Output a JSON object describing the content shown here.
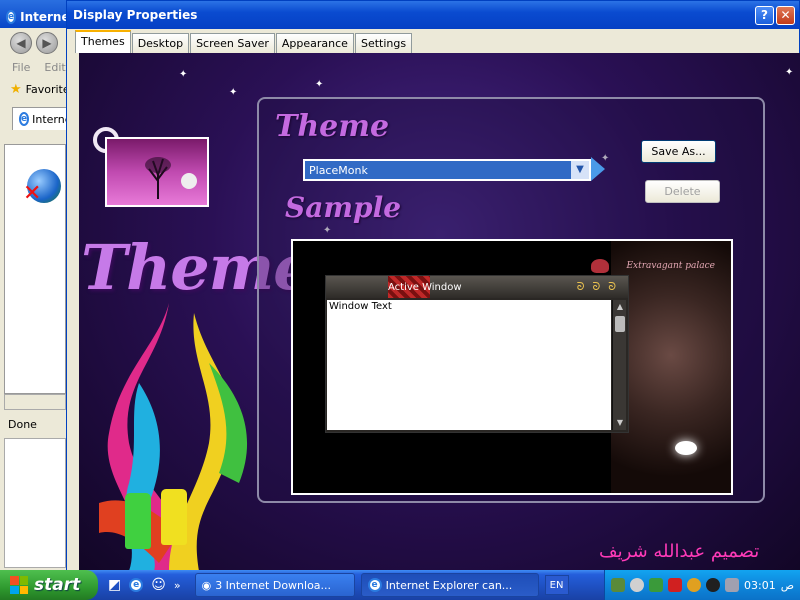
{
  "background_window": {
    "title": "Internet Explorer",
    "menu": [
      "File",
      "Edit"
    ],
    "favorites_label": "Favorites",
    "tab_label": "Internet Explorer",
    "status_text": "Done"
  },
  "dialog": {
    "title": "Display Properties",
    "tabs": [
      "Themes",
      "Desktop",
      "Screen Saver",
      "Appearance",
      "Settings"
    ],
    "active_tab": "Themes",
    "theme_label": "Theme",
    "theme_selected": "PlaceMonk",
    "save_as_label": "Save As...",
    "delete_label": "Delete",
    "sample_label": "Sample",
    "big_title": "Themes",
    "preview": {
      "active_window_title": "Active Window",
      "window_text": "Window Text",
      "brand_text": "Extravagant palace"
    },
    "designer_credit": "تصميم عبدالله شريف"
  },
  "taskbar": {
    "start_label": "start",
    "quicklaunch_more": "»",
    "tasks": [
      {
        "label": "3 Internet Downloa...",
        "active": false
      },
      {
        "label": "Internet Explorer can...",
        "active": true
      }
    ],
    "language": "EN",
    "clock": "03:01",
    "ampm": "ص"
  },
  "colors": {
    "xp_title_blue": "#0a4bd0",
    "taskbar_blue": "#245edb",
    "start_green": "#2f9a2f",
    "theme_label_purple": "#c46ae0",
    "credit_pink": "#ff3ab8",
    "selected_blue": "#316ac5"
  }
}
